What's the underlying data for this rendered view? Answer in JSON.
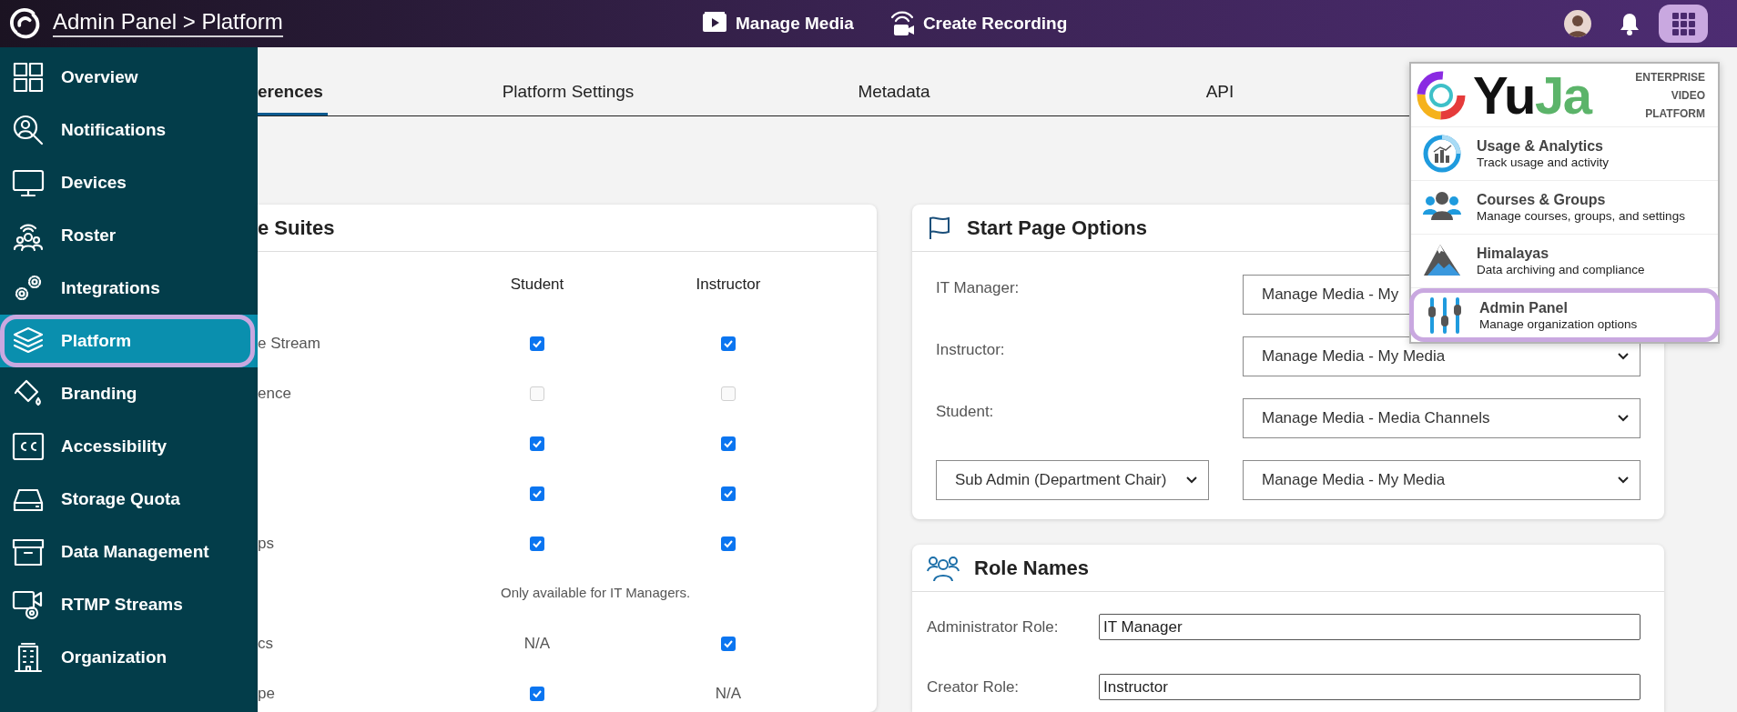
{
  "header": {
    "breadcrumb": "Admin Panel > Platform",
    "apps_open": true,
    "actions": [
      {
        "label": "Manage Media"
      },
      {
        "label": "Create Recording"
      }
    ]
  },
  "sidebar": {
    "items": [
      {
        "label": "Overview",
        "selected": false
      },
      {
        "label": "Notifications",
        "selected": false
      },
      {
        "label": "Devices",
        "selected": false
      },
      {
        "label": "Roster",
        "selected": false
      },
      {
        "label": "Integrations",
        "selected": false
      },
      {
        "label": "Platform",
        "selected": true
      },
      {
        "label": "Branding",
        "selected": false
      },
      {
        "label": "Accessibility",
        "selected": false
      },
      {
        "label": "Storage Quota",
        "selected": false
      },
      {
        "label": "Data Management",
        "selected": false
      },
      {
        "label": "RTMP Streams",
        "selected": false
      },
      {
        "label": "Organization",
        "selected": false
      }
    ]
  },
  "tabs": [
    {
      "label": "erences",
      "selected": true
    },
    {
      "label": "Platform Settings",
      "selected": false
    },
    {
      "label": "Metadata",
      "selected": false
    },
    {
      "label": "API",
      "selected": false
    }
  ],
  "suites_card": {
    "title": "e Suites",
    "columns": [
      "Student",
      "Instructor"
    ],
    "rows": [
      {
        "kind": "cells",
        "label": "e Stream",
        "cells": [
          {
            "kind": "checkbox",
            "checked": true,
            "disabled": false
          },
          {
            "kind": "checkbox",
            "checked": true,
            "disabled": false
          }
        ]
      },
      {
        "kind": "cells",
        "label": "ence",
        "cells": [
          {
            "kind": "checkbox",
            "checked": false,
            "disabled": true
          },
          {
            "kind": "checkbox",
            "checked": false,
            "disabled": true
          }
        ]
      },
      {
        "kind": "cells",
        "cells": [
          {
            "kind": "checkbox",
            "checked": true,
            "disabled": false
          },
          {
            "kind": "checkbox",
            "checked": true,
            "disabled": false
          }
        ]
      },
      {
        "kind": "cells",
        "cells": [
          {
            "kind": "checkbox",
            "checked": true,
            "disabled": false
          },
          {
            "kind": "checkbox",
            "checked": true,
            "disabled": false
          }
        ]
      },
      {
        "kind": "cells",
        "label": "ps",
        "cells": [
          {
            "kind": "checkbox",
            "checked": true,
            "disabled": false
          },
          {
            "kind": "checkbox",
            "checked": true,
            "disabled": false
          }
        ]
      },
      {
        "kind": "note",
        "text": "Only available for IT Managers."
      },
      {
        "kind": "cells",
        "label": "cs",
        "cells": [
          {
            "kind": "text",
            "text": "N/A"
          },
          {
            "kind": "checkbox",
            "checked": true,
            "disabled": false
          }
        ]
      },
      {
        "kind": "cells",
        "label": "pe",
        "cells": [
          {
            "kind": "checkbox",
            "checked": true,
            "disabled": false
          },
          {
            "kind": "text",
            "text": "N/A"
          }
        ]
      }
    ]
  },
  "start_page": {
    "title": "Start Page Options",
    "rows": [
      {
        "kind": "label",
        "label": "IT Manager:",
        "select": "Manage Media - My",
        "chevron": false
      },
      {
        "kind": "label",
        "label": "Instructor:",
        "select": "Manage Media - My Media"
      },
      {
        "kind": "label",
        "label": "Student:",
        "select": "Manage Media - Media Channels"
      },
      {
        "kind": "role_select",
        "role": "Sub Admin (Department Chair)",
        "select": "Manage Media - My Media"
      }
    ]
  },
  "role_names": {
    "title": "Role Names",
    "fields": [
      {
        "label": "Administrator Role:",
        "value": "IT Manager"
      },
      {
        "label": "Creator Role:",
        "value": "Instructor"
      }
    ]
  },
  "app_menu": {
    "brand": [
      {
        "text": "Yu",
        "color": "#111111"
      },
      {
        "text": "Ja",
        "color": "#5cb46a"
      }
    ],
    "tagline": [
      "ENTERPRISE",
      "VIDEO",
      "PLATFORM"
    ],
    "items": [
      {
        "title": "Usage & Analytics",
        "subtitle": "Track usage and activity",
        "selected": false
      },
      {
        "title": "Courses & Groups",
        "subtitle": "Manage courses, groups, and settings",
        "selected": false
      },
      {
        "title": "Himalayas",
        "subtitle": "Data archiving and compliance",
        "selected": false
      },
      {
        "title": "Admin Panel",
        "subtitle": "Manage organization options",
        "selected": true
      }
    ]
  }
}
